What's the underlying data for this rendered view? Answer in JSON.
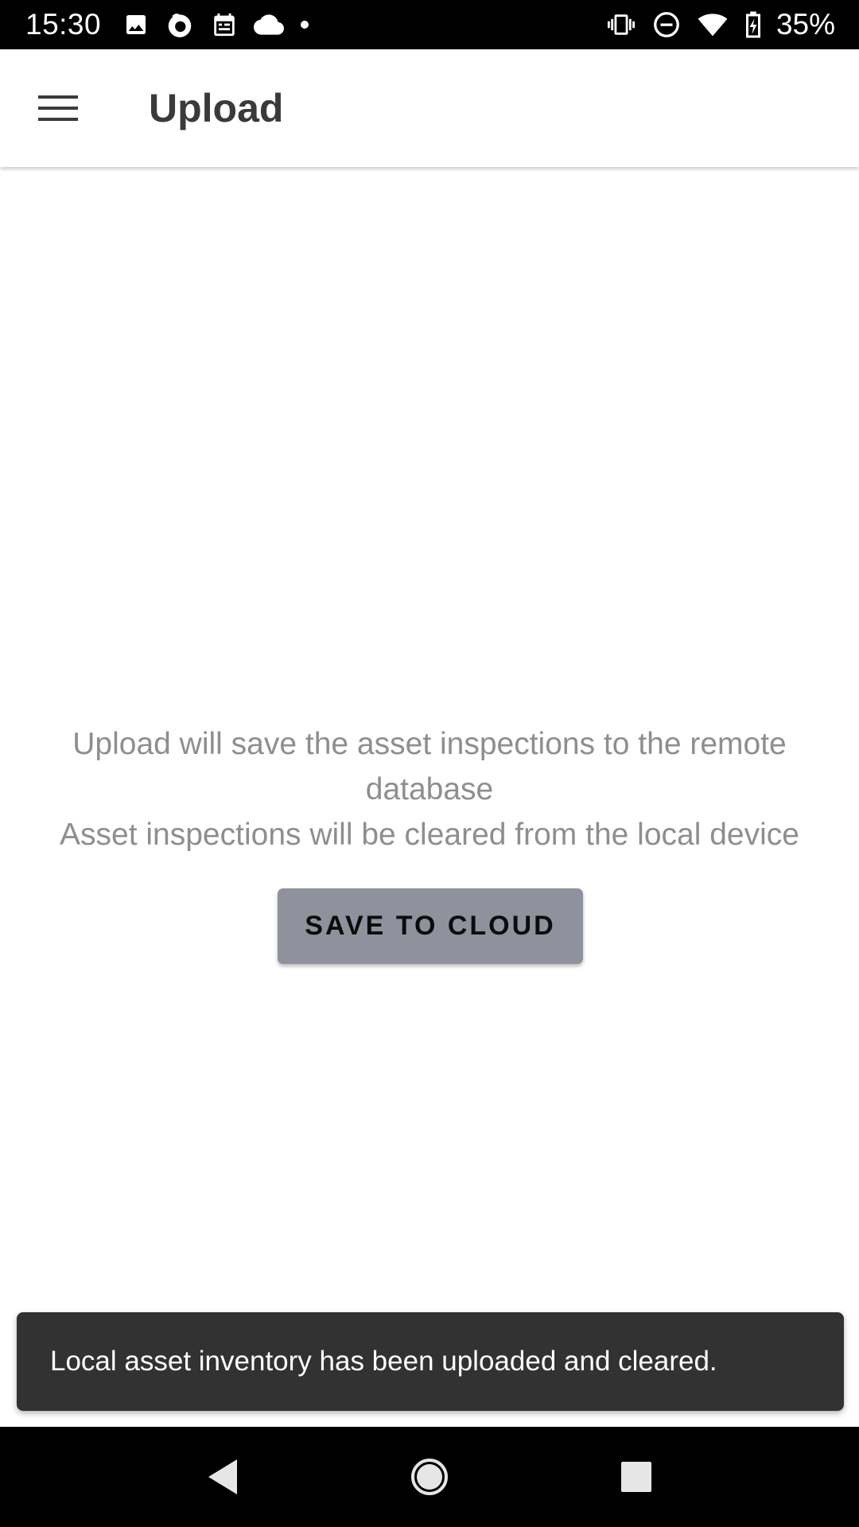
{
  "status_bar": {
    "time": "15:30",
    "battery_percent": "35%",
    "left_icons": [
      "image-icon",
      "firefox-icon",
      "calendar-icon",
      "cloud-icon",
      "dot-icon"
    ],
    "right_icons": [
      "vibrate-icon",
      "do-not-disturb-icon",
      "wifi-icon",
      "battery-charging-icon"
    ]
  },
  "app_bar": {
    "title": "Upload",
    "menu_icon": "hamburger-menu-icon"
  },
  "main": {
    "info_line_1": "Upload will save the asset inspections to the remote database",
    "info_line_2": "Asset inspections will be cleared from the local device",
    "save_button_label": "SAVE TO CLOUD"
  },
  "snackbar": {
    "message": "Local asset inventory has been uploaded and cleared."
  },
  "nav_bar": {
    "buttons": [
      "back-icon",
      "home-icon",
      "recents-icon"
    ]
  },
  "colors": {
    "button_bg": "#8f929c",
    "snackbar_bg": "#323232",
    "info_text": "#8e8e8e",
    "title_text": "#3a3a3a"
  }
}
